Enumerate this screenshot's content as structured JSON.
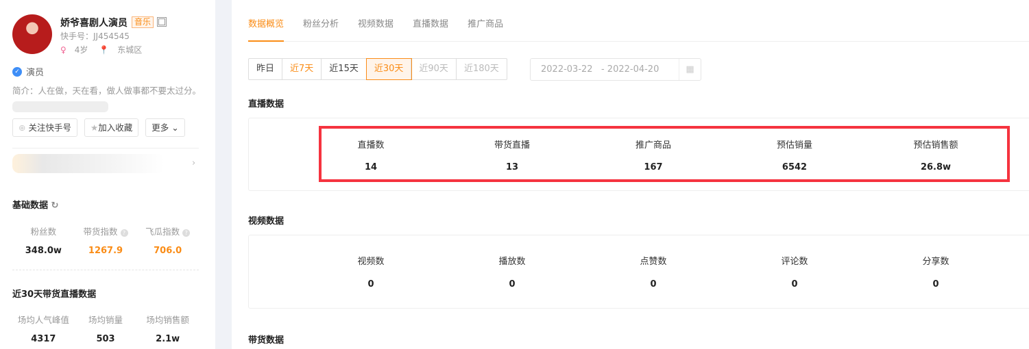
{
  "profile": {
    "name": "娇爷喜剧人演员",
    "tag": "音乐",
    "id": "快手号：JJ454545",
    "age": "4岁",
    "location": "东城区",
    "verified": "演员",
    "bio": "简介：人在做，天在看，做人做事都不要太过分。"
  },
  "actions": {
    "follow": "关注快手号",
    "favorite": "加入收藏",
    "more": "更多"
  },
  "basic": {
    "title": "基础数据",
    "stats": [
      {
        "label": "粉丝数",
        "value": "348.0w"
      },
      {
        "label": "带货指数",
        "value": "1267.9"
      },
      {
        "label": "飞瓜指数",
        "value": "706.0"
      }
    ]
  },
  "live30": {
    "title": "近30天带货直播数据",
    "stats": [
      {
        "label": "场均人气峰值",
        "value": "4317"
      },
      {
        "label": "场均销量",
        "value": "503"
      },
      {
        "label": "场均销售额",
        "value": "2.1w"
      }
    ]
  },
  "tabs": [
    "数据概览",
    "粉丝分析",
    "视频数据",
    "直播数据",
    "推广商品"
  ],
  "ranges": [
    "昨日",
    "近7天",
    "近15天",
    "近30天",
    "近90天",
    "近180天"
  ],
  "date": {
    "start": "2022-03-22",
    "end": "2022-04-20"
  },
  "live": {
    "title": "直播数据",
    "labels": [
      "直播数",
      "带货直播",
      "推广商品",
      "预估销量",
      "预估销售额"
    ],
    "values": [
      "14",
      "13",
      "167",
      "6542",
      "26.8w"
    ]
  },
  "video": {
    "title": "视频数据",
    "labels": [
      "视频数",
      "播放数",
      "点赞数",
      "评论数",
      "分享数"
    ],
    "values": [
      "0",
      "0",
      "0",
      "0",
      "0"
    ]
  },
  "goods": {
    "title": "带货数据"
  },
  "colors": {
    "accent": "#fa8c16",
    "highlight": "#f5333f"
  }
}
